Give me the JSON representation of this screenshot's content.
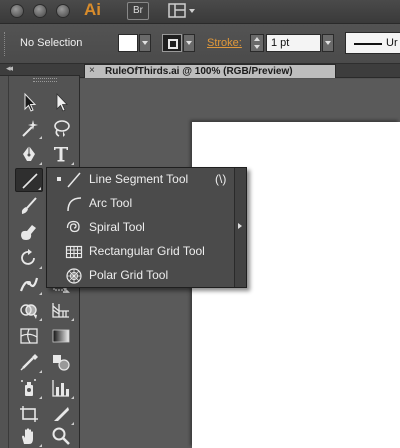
{
  "titlebar": {
    "app_name": "Ai",
    "bridge_label": "Br",
    "traffic_lights": [
      "close-button",
      "minimize-button",
      "zoom-button"
    ],
    "workspace_icon": "grid-layout-icon"
  },
  "control_bar": {
    "selection_label": "No Selection",
    "fill_color": "#ffffff",
    "stroke_color": "#1f1f1f",
    "stroke_label": "Stroke:",
    "stroke_weight": "1 pt",
    "profile_label": "Ur"
  },
  "document": {
    "tab_title": "RuleOfThirds.ai @ 100% (RGB/Preview)",
    "close_glyph": "×"
  },
  "tools": [
    "selection-tool",
    "direct-selection-tool",
    "magic-wand-tool",
    "lasso-tool",
    "pen-tool",
    "type-tool",
    "line-segment-tool",
    "rectangle-tool",
    "paintbrush-tool",
    "pencil-tool",
    "blob-brush-tool",
    "eraser-tool",
    "rotate-tool",
    "scale-tool",
    "width-tool",
    "free-transform-tool",
    "shape-builder-tool",
    "perspective-grid-tool",
    "mesh-tool",
    "gradient-tool",
    "eyedropper-tool",
    "blend-tool",
    "symbol-sprayer-tool",
    "column-graph-tool",
    "artboard-tool",
    "slice-tool",
    "hand-tool",
    "zoom-tool"
  ],
  "flyout": {
    "items": [
      {
        "label": "Line Segment Tool",
        "shortcut": "(\\)",
        "icon": "line-segment-icon",
        "selected": true
      },
      {
        "label": "Arc Tool",
        "shortcut": "",
        "icon": "arc-icon",
        "selected": false
      },
      {
        "label": "Spiral Tool",
        "shortcut": "",
        "icon": "spiral-icon",
        "selected": false
      },
      {
        "label": "Rectangular Grid Tool",
        "shortcut": "",
        "icon": "rectangular-grid-icon",
        "selected": false
      },
      {
        "label": "Polar Grid Tool",
        "shortcut": "",
        "icon": "polar-grid-icon",
        "selected": false
      }
    ]
  },
  "colors": {
    "accent_orange": "#e0983a",
    "panel_bg": "#535353",
    "menu_bg": "#4b4b4b"
  }
}
